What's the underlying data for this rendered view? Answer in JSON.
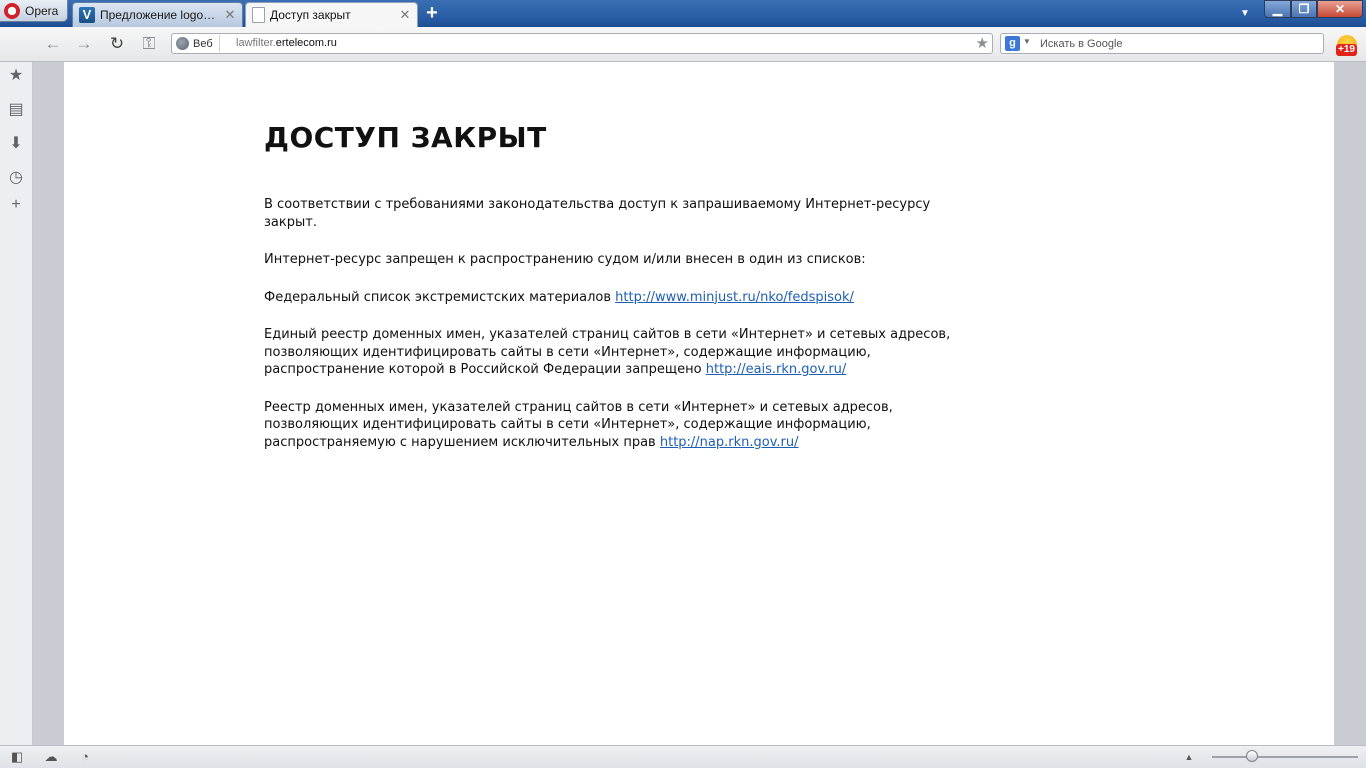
{
  "browser": {
    "menu_label": "Opera",
    "tabs": [
      {
        "title": "Предложение logon Ко...",
        "favicon": "v-site-icon"
      },
      {
        "title": "Доступ закрыт",
        "favicon": "page-icon"
      }
    ],
    "new_tab_label": "+",
    "address_badge": "Веб",
    "address_host_prefix": "lawfilter.",
    "address_host_main": "ertelecom.ru",
    "search_placeholder": "Искать в Google",
    "search_engine_letter": "g",
    "notification_count": "+19"
  },
  "page": {
    "heading": "ДОСТУП ЗАКРЫТ",
    "intro": "В соответствии с требованиями законодательства доступ к запрашиваемому Интернет-ресурсу закрыт.",
    "lists_intro": "Интернет-ресурс запрещен к распространению судом и/или внесен в один из списков:",
    "items": [
      {
        "text": "Федеральный список экстремистских материалов ",
        "link": "http://www.minjust.ru/nko/fedspisok/"
      },
      {
        "text": "Единый реестр доменных имен, указателей страниц сайтов в сети «Интернет» и сетевых адресов, позволяющих идентифицировать сайты в сети «Интернет», содержащие информацию, распространение которой в Российской Федерации запрещено ",
        "link": "http://eais.rkn.gov.ru/"
      },
      {
        "text": "Реестр доменных имен, указателей страниц сайтов в сети «Интернет» и сетевых адресов, позволяющих идентифицировать сайты в сети «Интернет», содержащие информацию, распространяемую с нарушением исключительных прав ",
        "link": "http://nap.rkn.gov.ru/"
      }
    ]
  },
  "colors": {
    "link": "#1f5fb3",
    "titlebar": "#2a5ea6"
  }
}
